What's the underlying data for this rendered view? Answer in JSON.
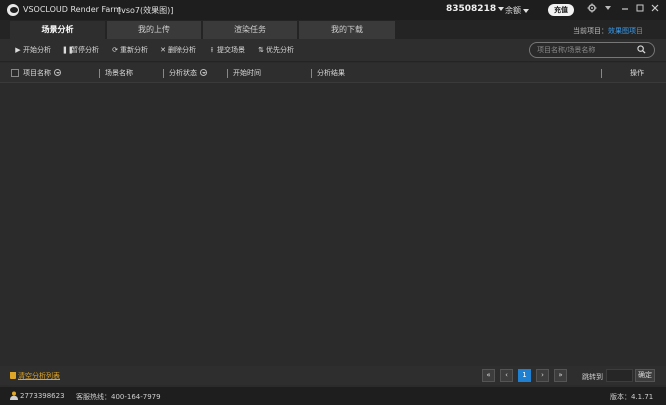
{
  "titlebar": {
    "app_title": "VSOCLOUD Render Farm",
    "project_title": "[vso7(效果图)]",
    "account_id": "83508218",
    "balance_label": "余额",
    "recharge_label": "充值"
  },
  "tabs": [
    {
      "label": "场景分析",
      "active": true
    },
    {
      "label": "我的上传",
      "active": false
    },
    {
      "label": "渲染任务",
      "active": false
    },
    {
      "label": "我的下载",
      "active": false
    }
  ],
  "current_project": {
    "label": "当前项目：",
    "value": "效果图项目"
  },
  "toolbar": {
    "buttons": [
      {
        "icon": "play-icon",
        "label": "开始分析"
      },
      {
        "icon": "pause-icon",
        "label": "暂停分析"
      },
      {
        "icon": "refresh-icon",
        "label": "重新分析"
      },
      {
        "icon": "close-icon",
        "label": "删除分析"
      },
      {
        "icon": "upload-icon",
        "label": "提交场景"
      },
      {
        "icon": "priority-icon",
        "label": "优先分析"
      }
    ],
    "search_placeholder": "项目名称/场景名称"
  },
  "table": {
    "columns": [
      "项目名称",
      "场景名称",
      "分析状态",
      "开始时间",
      "分析结果",
      "操作"
    ],
    "rows": []
  },
  "footer": {
    "clear_label": "清空分析列表",
    "pagination": {
      "first": "«",
      "prev": "‹",
      "current_page": "1",
      "next": "›",
      "last": "»"
    },
    "jump_label": "跳转到",
    "confirm_label": "确定"
  },
  "statusbar": {
    "user_id": "2773398623",
    "hotline_label": "客服热线：400-164-7979",
    "version_label": "版本：4.1.71"
  },
  "colors": {
    "accent": "#1f7fd1",
    "link": "#3c9ded",
    "warning": "#e0a628",
    "background": "#2b2b2b"
  }
}
